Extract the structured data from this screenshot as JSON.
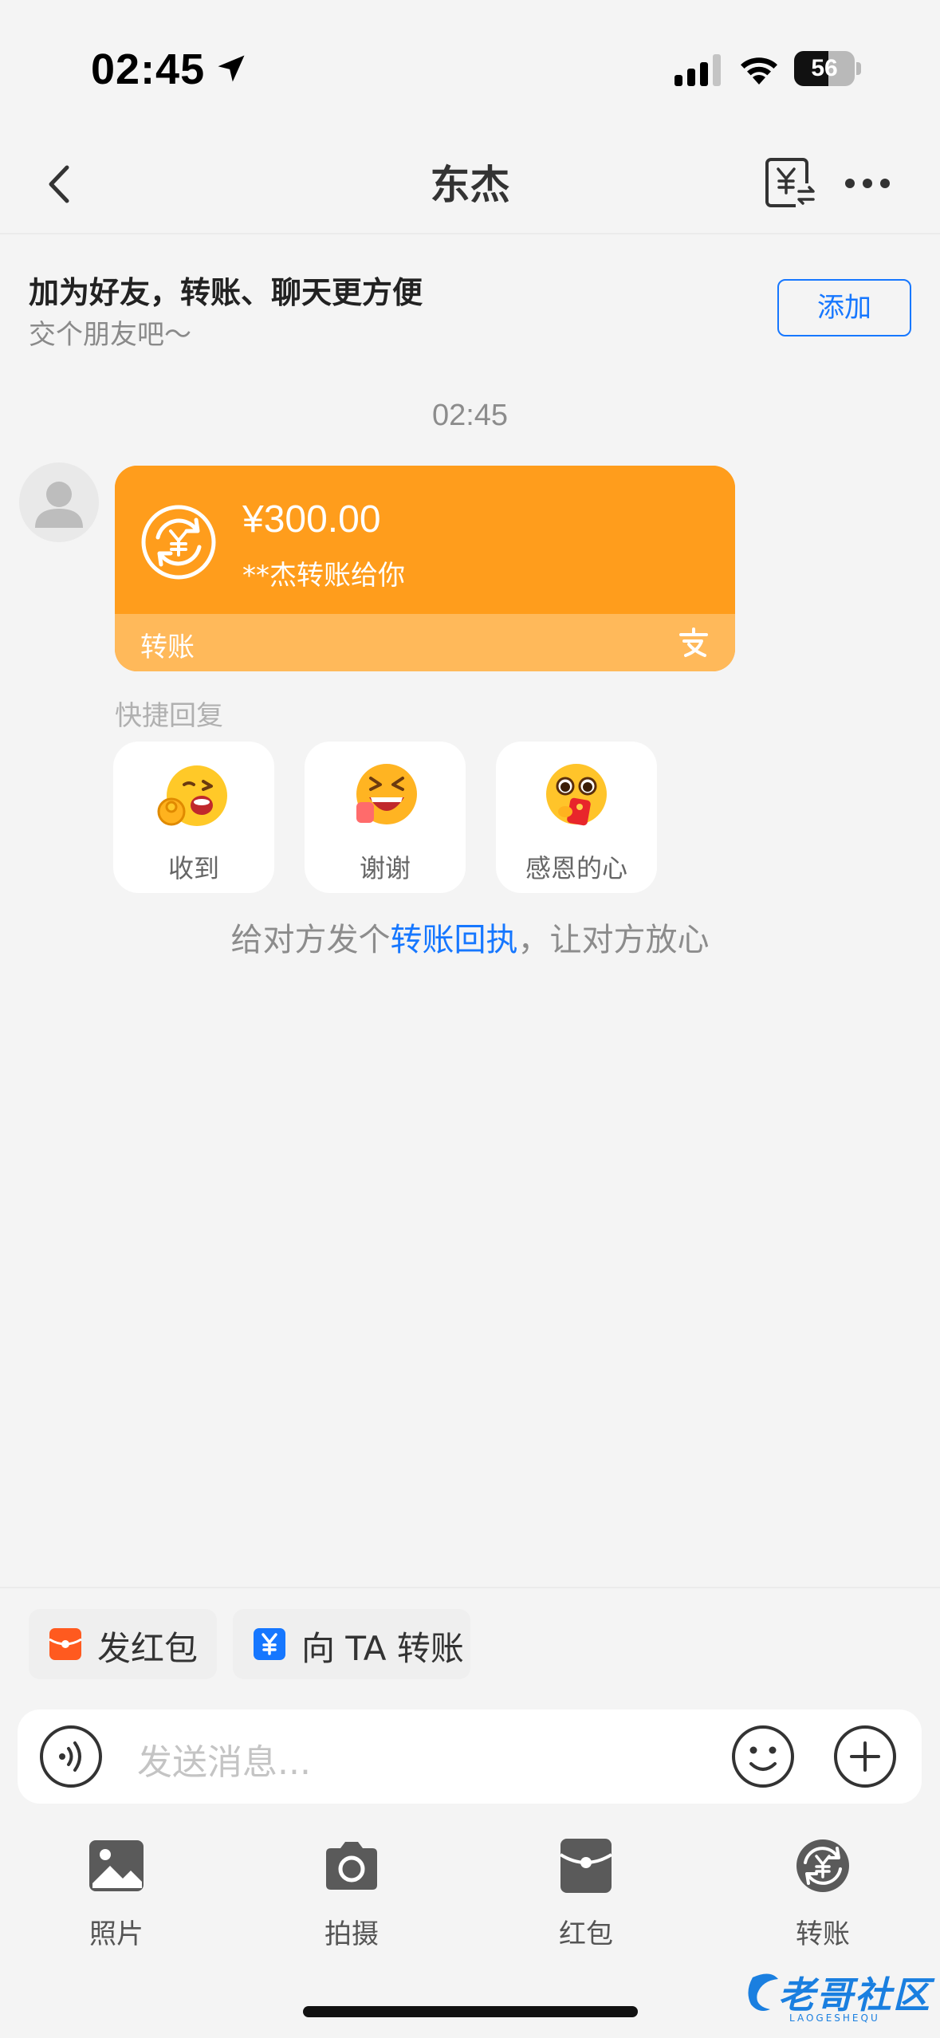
{
  "status_bar": {
    "time": "02:45",
    "battery": "56",
    "battery_level": 0.56
  },
  "nav": {
    "title": "东杰"
  },
  "add_friend": {
    "title": "加为好友，转账、聊天更方便",
    "subtitle": "交个朋友吧～",
    "button": "添加"
  },
  "chat": {
    "timestamp": "02:45",
    "transfer_card": {
      "amount": "¥300.00",
      "description": "**杰转账给你",
      "label": "转账"
    },
    "quick_reply": {
      "label": "快捷回复",
      "items": [
        {
          "text": "收到",
          "emoji": "ok-hand-wink-emoji"
        },
        {
          "text": "谢谢",
          "emoji": "laughing-emoji"
        },
        {
          "text": "感恩的心",
          "emoji": "grateful-red-envelope-emoji"
        }
      ]
    },
    "receipt": {
      "prefix": "给对方发个",
      "link": "转账回执",
      "suffix": "，让对方放心"
    }
  },
  "quick_actions": [
    {
      "label": "发红包",
      "icon": "red-envelope-icon",
      "color": "#ff5a1f"
    },
    {
      "label": "向 TA 转账",
      "icon": "yuan-transfer-icon",
      "color": "#1677ff"
    }
  ],
  "input": {
    "placeholder": "发送消息..."
  },
  "toolbar": [
    {
      "label": "照片",
      "icon": "photo-icon"
    },
    {
      "label": "拍摄",
      "icon": "camera-icon"
    },
    {
      "label": "红包",
      "icon": "red-envelope-icon"
    },
    {
      "label": "转账",
      "icon": "transfer-icon"
    }
  ],
  "watermark": {
    "text": "老哥社区",
    "sub": "LAOGESHEQU"
  },
  "colors": {
    "accent": "#1677ff",
    "card_orange": "#ff9d1c",
    "card_orange_light": "#ffb95a"
  }
}
